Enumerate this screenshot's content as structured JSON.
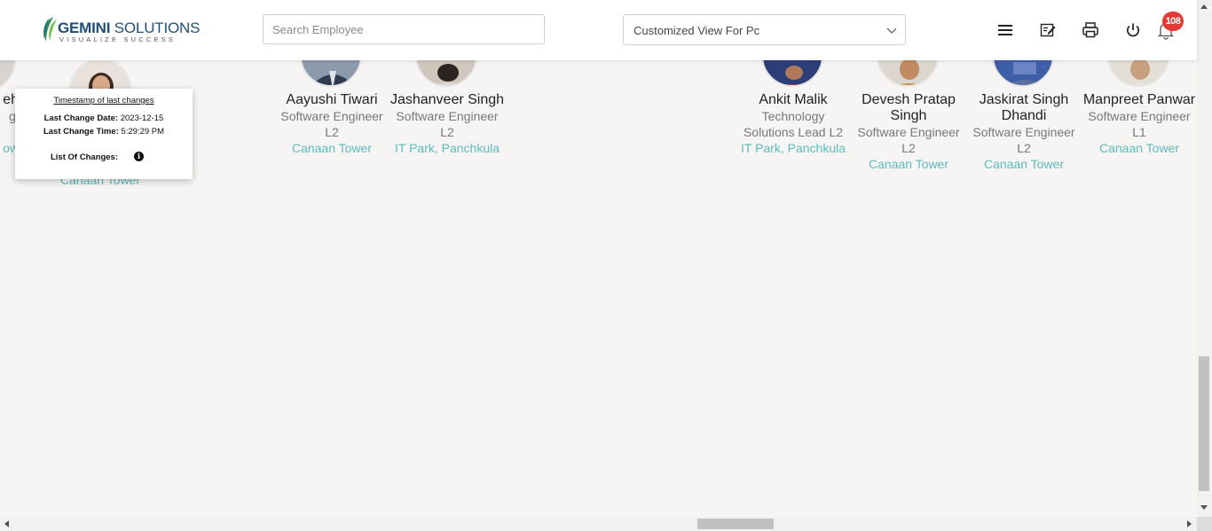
{
  "header": {
    "logo": {
      "name": "GEMINI",
      "name_suffix": "SOLUTIONS",
      "tagline": "VISUALIZE SUCCESS"
    },
    "search": {
      "placeholder": "Search Employee",
      "value": ""
    },
    "view_select": {
      "value": "Customized View For Pc"
    },
    "icons": [
      "menu-icon",
      "edit-note-icon",
      "print-icon",
      "power-icon",
      "bell-icon"
    ],
    "notification_count": "108"
  },
  "tooltip": {
    "title": "Timestamp of last changes",
    "date_label": "Last Change Date:",
    "date_value": "2023-12-15",
    "time_label": "Last Change Time:",
    "time_value": "5:29:29 PM",
    "changes_label": "List Of Changes:"
  },
  "employees": [
    {
      "name_partial": "eh",
      "role_partial": "gi",
      "loc_partial": "ow"
    },
    {
      "name": "",
      "role": "",
      "location": "Canaan Tower"
    },
    {
      "name": "Aayushi Tiwari",
      "role": "Software Engineer L2",
      "location": "Canaan Tower"
    },
    {
      "name": "Jashanveer Singh",
      "role": "Software Engineer L2",
      "location": "IT Park, Panchkula"
    },
    {
      "name": "Ankit Malik",
      "role": "Technology Solutions Lead L2",
      "location": "IT Park, Panchkula"
    },
    {
      "name": "Devesh Pratap Singh",
      "role": "Software Engineer L2",
      "location": "Canaan Tower"
    },
    {
      "name": "Jaskirat Singh Dhandi",
      "role": "Software Engineer L2",
      "location": "Canaan Tower"
    },
    {
      "name": "Manpreet Panwar",
      "role": "Software Engineer L1",
      "location": "Canaan Tower"
    }
  ],
  "colors": {
    "accent": "#5bbcbc",
    "badge": "#e53935",
    "brand": "#1f4e79"
  }
}
